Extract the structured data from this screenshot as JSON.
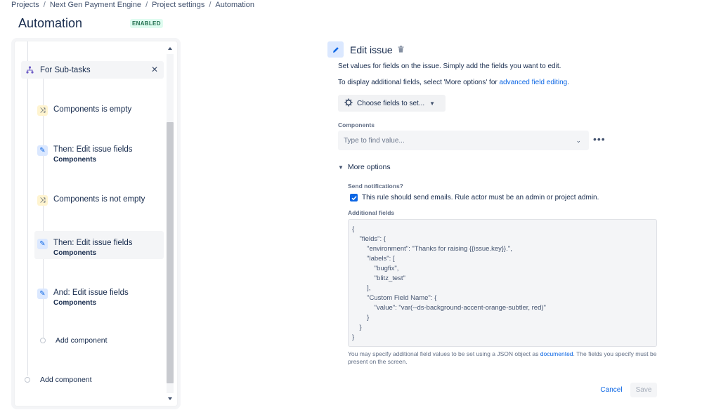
{
  "breadcrumb": {
    "items": [
      "Projects",
      "Next Gen Payment Engine",
      "Project settings",
      "Automation"
    ],
    "separator": "/"
  },
  "page": {
    "title": "Automation",
    "status": "ENABLED"
  },
  "rule": {
    "branch": {
      "label": "For Sub-tasks",
      "icon": "branch-icon"
    },
    "components": [
      {
        "title": "Components is empty",
        "subtitle": "",
        "kind": "condition",
        "icon": "shuffle-icon"
      },
      {
        "title": "Then: Edit issue fields",
        "subtitle": "Components",
        "kind": "action",
        "icon": "pencil-icon"
      },
      {
        "title": "Components is not empty",
        "subtitle": "",
        "kind": "condition",
        "icon": "shuffle-icon"
      },
      {
        "title": "Then: Edit issue fields",
        "subtitle": "Components",
        "kind": "action",
        "icon": "pencil-icon",
        "selected": true
      },
      {
        "title": "And: Edit issue fields",
        "subtitle": "Components",
        "kind": "action",
        "icon": "pencil-icon"
      }
    ],
    "add_component_inner": "Add component",
    "add_component_outer": "Add component"
  },
  "editor": {
    "title": "Edit issue",
    "description": "Set values for fields on the issue. Simply add the fields you want to edit.",
    "additional_prefix": "To display additional fields, select 'More options' for ",
    "additional_link": "advanced field editing",
    "additional_suffix": ".",
    "choose_fields_label": "Choose fields to set...",
    "components_label": "Components",
    "components_placeholder": "Type to find value...",
    "more_options_label": "More options",
    "send_notifications_label": "Send notifications?",
    "send_notifications_checked": true,
    "send_notifications_text": "This rule should send emails. Rule actor must be an admin or project admin.",
    "additional_fields_label": "Additional fields",
    "json_lines": [
      "{",
      "    \"fields\": {",
      "        \"environment\": \"Thanks for raising {{issue.key}}.\",",
      "        \"labels\": [",
      "            \"bugfix\",",
      "            \"blitz_test\"",
      "        ],",
      "        \"Custom Field Name\": {",
      "            \"value\": \"var(--ds-background-accent-orange-subtler, red)\"",
      "        }",
      "    }",
      "}"
    ],
    "help_prefix": "You may specify additional field values to be set using a JSON object as ",
    "help_link": "documented",
    "help_suffix": ". The fields you specify must be present on the screen.",
    "cancel_label": "Cancel",
    "save_label": "Save"
  },
  "colors": {
    "accent": "#0c66e4",
    "enabled_bg": "#dffcf0",
    "enabled_fg": "#216e4e",
    "condition_bg": "#fff4d0",
    "action_bg": "#dbe8ff"
  }
}
